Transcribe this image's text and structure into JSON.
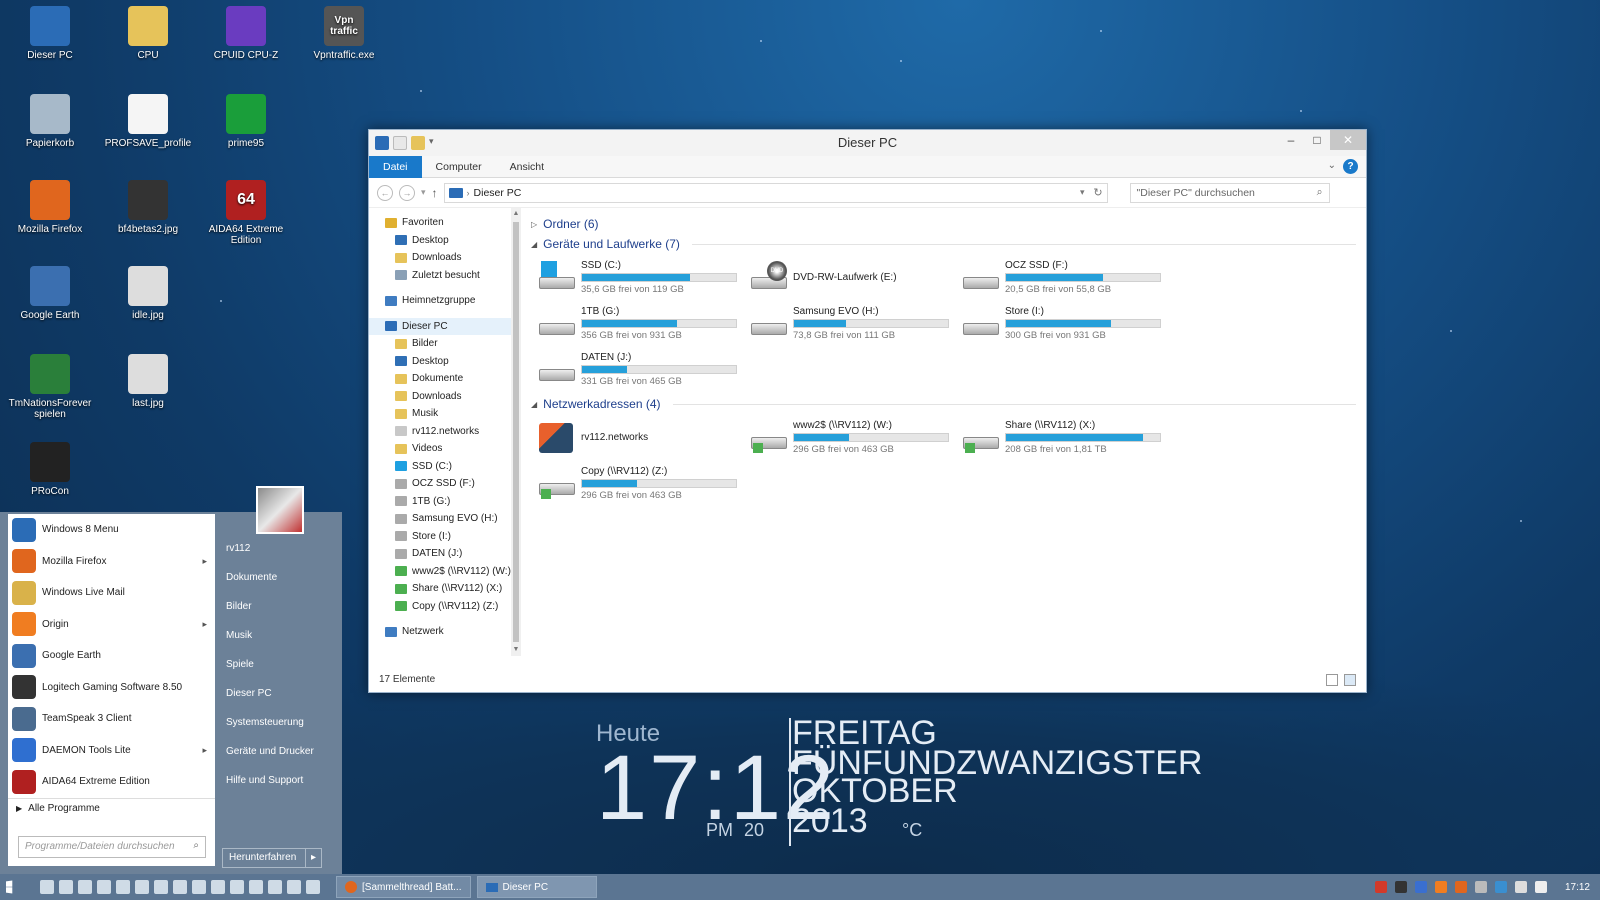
{
  "desktop": {
    "icons": [
      {
        "label": "Dieser PC"
      },
      {
        "label": "CPU"
      },
      {
        "label": "CPUID CPU-Z"
      },
      {
        "label": "Vpntraffic.exe",
        "badge": "Vpn traffic"
      },
      {
        "label": "Papierkorb"
      },
      {
        "label": "PROFSAVE_profile"
      },
      {
        "label": "prime95"
      },
      {
        "label": "Mozilla Firefox"
      },
      {
        "label": "bf4betas2.jpg"
      },
      {
        "label": "AIDA64 Extreme Edition",
        "badge": "64"
      },
      {
        "label": "Google Earth"
      },
      {
        "label": "idle.jpg"
      },
      {
        "label": "TmNationsForever spielen"
      },
      {
        "label": "last.jpg"
      },
      {
        "label": "PRoCon"
      }
    ]
  },
  "explorer": {
    "title": "Dieser PC",
    "ribbon_tabs": [
      "Datei",
      "Computer",
      "Ansicht"
    ],
    "help": "?",
    "address": "Dieser PC",
    "search_placeholder": "\"Dieser PC\" durchsuchen",
    "nav": [
      {
        "label": "Favoriten",
        "color": "#e0b030"
      },
      {
        "label": "Desktop",
        "color": "#2f6fb5"
      },
      {
        "label": "Downloads",
        "color": "#e6c35a"
      },
      {
        "label": "Zuletzt besucht",
        "color": "#8aa0b6"
      },
      {
        "label": "Heimnetzgruppe",
        "color": "#3f7cc1"
      },
      {
        "label": "Dieser PC",
        "color": "#2b6cb6"
      },
      {
        "label": "Bilder",
        "color": "#e6c35a"
      },
      {
        "label": "Desktop",
        "color": "#2f6fb5"
      },
      {
        "label": "Dokumente",
        "color": "#e6c35a"
      },
      {
        "label": "Downloads",
        "color": "#e6c35a"
      },
      {
        "label": "Musik",
        "color": "#e6c35a"
      },
      {
        "label": "rv112.networks",
        "color": "#c8c8c8"
      },
      {
        "label": "Videos",
        "color": "#e6c35a"
      },
      {
        "label": "SSD (C:)",
        "color": "#1ea0e1"
      },
      {
        "label": "OCZ SSD (F:)",
        "color": "#aaaaaa"
      },
      {
        "label": "1TB (G:)",
        "color": "#aaaaaa"
      },
      {
        "label": "Samsung EVO (H:)",
        "color": "#aaaaaa"
      },
      {
        "label": "Store (I:)",
        "color": "#aaaaaa"
      },
      {
        "label": "DATEN (J:)",
        "color": "#aaaaaa"
      },
      {
        "label": "www2$ (\\\\RV112) (W:)",
        "color": "#4caf50"
      },
      {
        "label": "Share (\\\\RV112) (X:)",
        "color": "#4caf50"
      },
      {
        "label": "Copy (\\\\RV112) (Z:)",
        "color": "#4caf50"
      },
      {
        "label": "Netzwerk",
        "color": "#3f7cc1"
      }
    ],
    "sections": {
      "folders": "Ordner (6)",
      "drives": "Geräte und Laufwerke (7)",
      "network": "Netzwerkadressen (4)"
    },
    "drives": [
      {
        "name": "SSD (C:)",
        "free": "35,6 GB frei von 119 GB",
        "used_pct": 70,
        "kind": "win"
      },
      {
        "name": "DVD-RW-Laufwerk (E:)",
        "free": "",
        "used_pct": null,
        "kind": "dvd"
      },
      {
        "name": "OCZ SSD (F:)",
        "free": "20,5 GB frei von 55,8 GB",
        "used_pct": 63,
        "kind": "hdd"
      },
      {
        "name": "1TB (G:)",
        "free": "356 GB frei von 931 GB",
        "used_pct": 62,
        "kind": "hdd"
      },
      {
        "name": "Samsung EVO (H:)",
        "free": "73,8 GB frei von 111 GB",
        "used_pct": 34,
        "kind": "hdd"
      },
      {
        "name": "Store (I:)",
        "free": "300 GB frei von 931 GB",
        "used_pct": 68,
        "kind": "hdd"
      },
      {
        "name": "DATEN (J:)",
        "free": "331 GB frei von 465 GB",
        "used_pct": 29,
        "kind": "hdd"
      }
    ],
    "network": [
      {
        "name": "rv112.networks",
        "free": "",
        "used_pct": null,
        "kind": "app"
      },
      {
        "name": "www2$ (\\\\RV112) (W:)",
        "free": "296 GB frei von 463 GB",
        "used_pct": 36,
        "kind": "net"
      },
      {
        "name": "Share (\\\\RV112) (X:)",
        "free": "208 GB frei von 1,81 TB",
        "used_pct": 89,
        "kind": "net"
      },
      {
        "name": "Copy (\\\\RV112) (Z:)",
        "free": "296 GB frei von 463 GB",
        "used_pct": 36,
        "kind": "net"
      }
    ],
    "status": "17 Elemente"
  },
  "startmenu": {
    "left": [
      {
        "label": "Windows 8 Menu",
        "color": "#2b6cb6",
        "arrow": false
      },
      {
        "label": "Mozilla Firefox",
        "color": "#e0661e",
        "arrow": true
      },
      {
        "label": "Windows Live Mail",
        "color": "#d9b24a",
        "arrow": false
      },
      {
        "label": "Origin",
        "color": "#f07d21",
        "arrow": true
      },
      {
        "label": "Google Earth",
        "color": "#3b6fb0",
        "arrow": false
      },
      {
        "label": "Logitech Gaming Software 8.50",
        "color": "#333333",
        "arrow": false
      },
      {
        "label": "TeamSpeak 3 Client",
        "color": "#4a6b8f",
        "arrow": false
      },
      {
        "label": "DAEMON Tools Lite",
        "color": "#2f6fd0",
        "arrow": true
      },
      {
        "label": "AIDA64 Extreme Edition",
        "color": "#b02020",
        "arrow": false
      }
    ],
    "all_programs": "Alle Programme",
    "search_placeholder": "Programme/Dateien durchsuchen",
    "right": [
      "rv112",
      "Dokumente",
      "Bilder",
      "Musik",
      "Spiele",
      "Dieser PC",
      "Systemsteuerung",
      "Geräte und Drucker",
      "Hilfe und Support"
    ],
    "shutdown": "Herunterfahren"
  },
  "clock": {
    "heute": "Heute",
    "time": "17:12",
    "ampm": "PM",
    "pm_number": "20",
    "day_lines": [
      "FREITAG",
      "FÜNFUNDZWANZIGSTER",
      "OKTOBER",
      "2013"
    ],
    "unit": "°C"
  },
  "taskbar": {
    "tasks": [
      "[Sammelthread] Batt...",
      "Dieser PC"
    ],
    "time": "17:12"
  }
}
